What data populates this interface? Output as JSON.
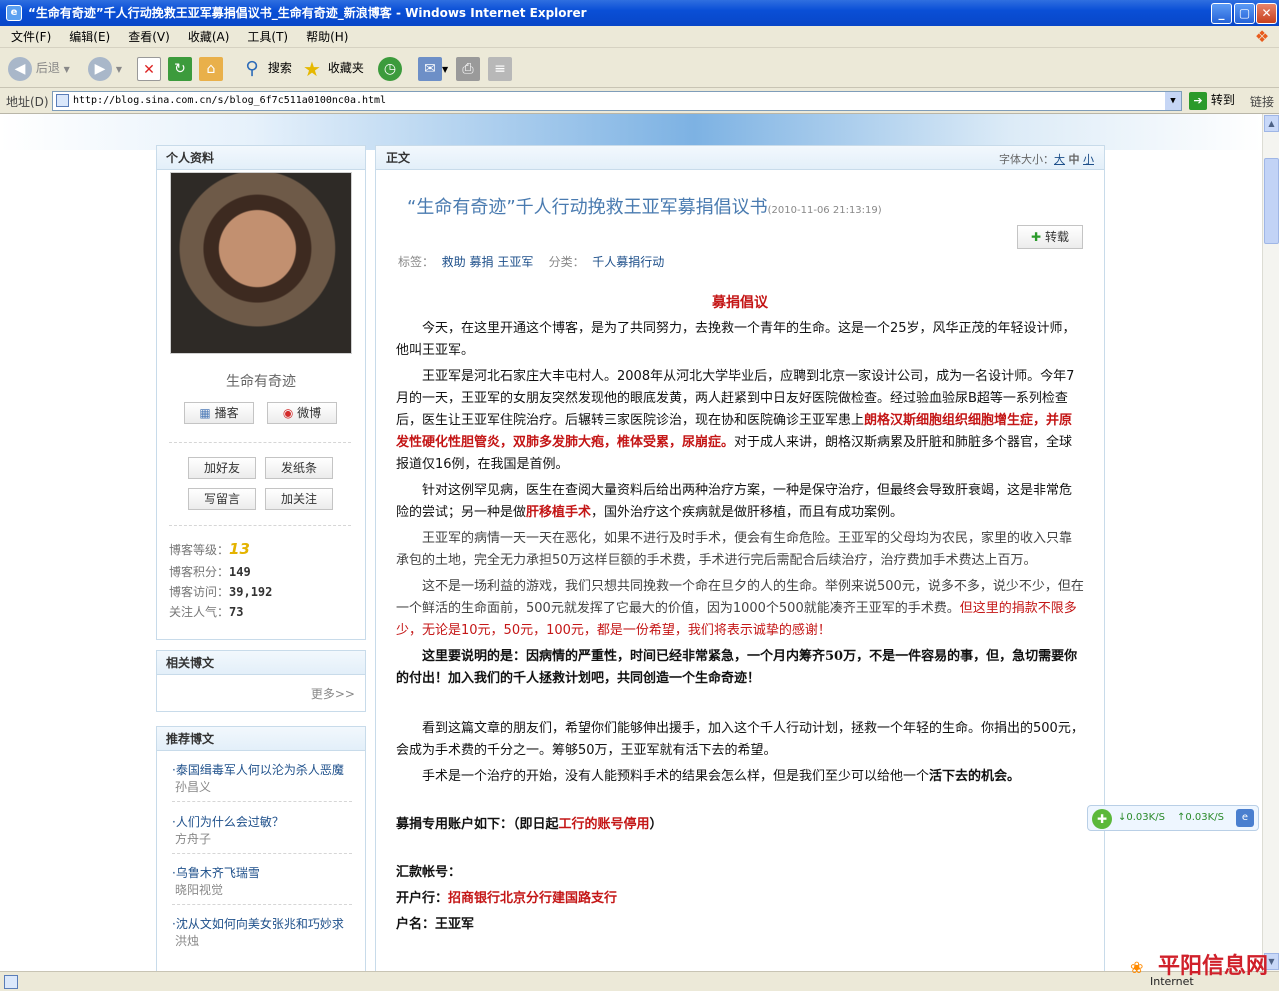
{
  "window": {
    "title": "“生命有奇迹”千人行动挽救王亚军募捐倡议书_生命有奇迹_新浪博客 - Windows Internet Explorer",
    "min": "_",
    "max": "▢",
    "close": "✕"
  },
  "menu": [
    "文件(F)",
    "编辑(E)",
    "查看(V)",
    "收藏(A)",
    "工具(T)",
    "帮助(H)"
  ],
  "toolbar": {
    "back": "后退",
    "search": "搜索",
    "favorites": "收藏夹"
  },
  "address": {
    "label": "地址(D)",
    "url": "http://blog.sina.com.cn/s/blog_6f7c511a0100nc0a.html",
    "go": "转到",
    "links": "链接"
  },
  "profile": {
    "header": "个人资料",
    "name": "生命有奇迹",
    "buttons": [
      "播客",
      "微博",
      "加好友",
      "发纸条",
      "写留言",
      "加关注"
    ],
    "stats": [
      {
        "label": "博客等级：",
        "value": "13"
      },
      {
        "label": "博客积分：",
        "value": "149"
      },
      {
        "label": "博客访问：",
        "value": "39,192"
      },
      {
        "label": "关注人气：",
        "value": "73"
      }
    ]
  },
  "related": {
    "header": "相关博文",
    "more": "更多>>"
  },
  "recommended": {
    "header": "推荐博文",
    "items": [
      {
        "title": "泰国缉毒军人何以沦为杀人恶魔",
        "author": "孙昌义"
      },
      {
        "title": "人们为什么会过敏？",
        "author": "方舟子"
      },
      {
        "title": "乌鲁木齐飞瑞雪",
        "author": "晓阳视觉"
      },
      {
        "title": "沈从文如何向美女张兆和巧妙求",
        "author": "洪烛"
      }
    ]
  },
  "article": {
    "header": "正文",
    "fontsize_label": "字体大小：",
    "fontsize_options": [
      "大",
      "中",
      "小"
    ],
    "title": "“生命有奇迹”千人行动挽救王亚军募捐倡议书",
    "time": "(2010-11-06 21:13:19)",
    "reprint": "转载",
    "tags_label": "标签：",
    "tags": [
      "救助",
      "募捐",
      "王亚军"
    ],
    "category_label": "分类：",
    "category": "千人募捐行动",
    "heading": "募捐倡议",
    "p1": "今天，在这里开通这个博客，是为了共同努力，去挽救一个青年的生命。这是一个25岁，风华正茂的年轻设计师，他叫王亚军。",
    "p2a": "王亚军是河北石家庄大丰屯村人。2008年从河北大学毕业后，应聘到北京一家设计公司，成为一名设计师。今年7月的一天，王亚军的女朋友突然发现他的眼底发黄，两人赶紧到中日友好医院做检查。经过验血验尿B超等一系列检查后，医生让王亚军住院治疗。后辗转三家医院诊治，现在协和医院确诊王亚军患上",
    "p2b": "朗格汉斯细胞组织细胞增生症，并原发性硬化性胆管炎，双肺多发肺大疱，椎体受累，尿崩症。",
    "p2c": "对于成人来讲，朗格汉斯病累及肝脏和肺脏多个器官，全球报道仅16例，在我国是首例。",
    "p3a": "针对这例罕见病，医生在查阅大量资料后给出两种治疗方案，一种是保守治疗，但最终会导致肝衰竭，这是非常危险的尝试；另一种是做",
    "p3b": "肝移植手术",
    "p3c": "，国外治疗这个疾病就是做肝移植，而且有成功案例。",
    "p4": "王亚军的病情一天一天在恶化，如果不进行及时手术，便会有生命危险。王亚军的父母均为农民，家里的收入只靠承包的土地，完全无力承担50万这样巨额的手术费，手术进行完后需配合后续治疗，治疗费加手术费达上百万。",
    "p5a": "这不是一场利益的游戏，我们只想共同挽救一个命在旦夕的人的生命。举例来说500元，说多不多，说少不少，但在一个鲜活的生命面前，500元就发挥了它最大的价值，因为1000个500就能凑齐王亚军的手术费。",
    "p5b": "但这里的捐款不限多少，无论是10元，50元，100元，都是一份希望，我们将表示诚挚的感谢！",
    "p6": "这里要说明的是：因病情的严重性，时间已经非常紧急，一个月内筹齐50万，不是一件容易的事，但，急切需要你的付出！加入我们的千人拯救计划吧，共同创造一个生命奇迹！",
    "p7": "看到这篇文章的朋友们，希望你们能够伸出援手，加入这个千人行动计划，拯救一个年轻的生命。你捐出的500元，会成为手术费的千分之一。筹够50万，王亚军就有活下去的希望。",
    "p8a": "手术是一个治疗的开始，没有人能预料手术的结果会怎么样，但是我们至少可以给他一个",
    "p8b": "活下去的机会。",
    "acct_a": "募捐专用账户如下：（即日起",
    "acct_b": "工行的账号停用",
    "acct_c": "）",
    "remit": "汇款帐号：",
    "bank_label": "开户行：",
    "bank": "招商银行北京分行建国路支行",
    "holder_label": "户名：",
    "holder": "王亚军"
  },
  "netwidget": {
    "down": "↓0.03K/S",
    "up": "↑0.03K/S"
  },
  "statusbar": {
    "zone": "Internet"
  },
  "watermark": "平阳信息网"
}
